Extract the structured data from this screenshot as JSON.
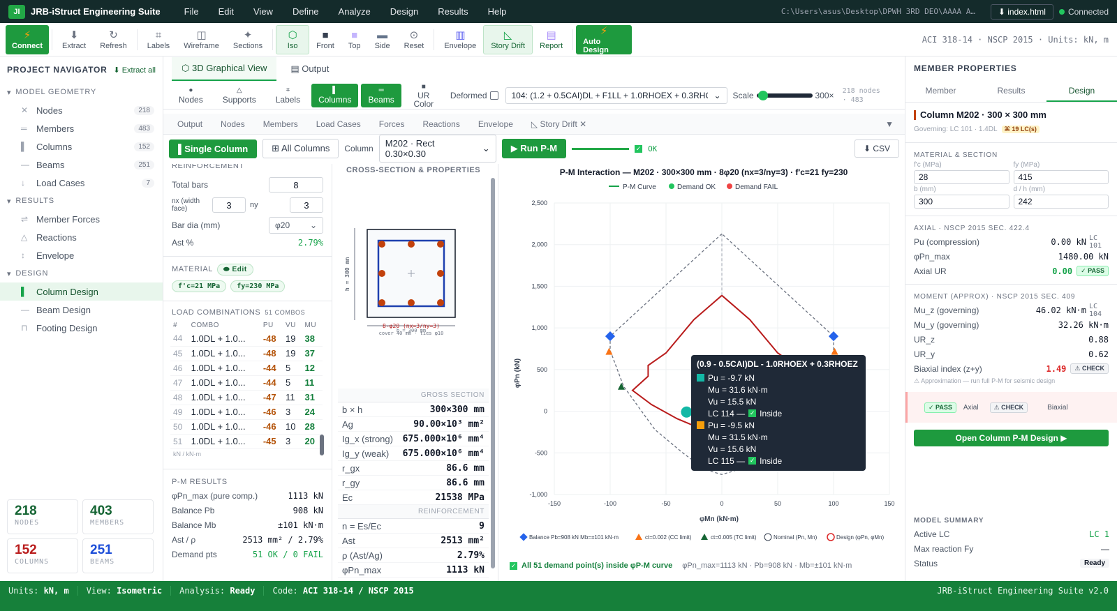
{
  "app": {
    "logo": "JI",
    "title": "JRB-iStruct Engineering Suite",
    "menus": [
      "File",
      "Edit",
      "View",
      "Define",
      "Analyze",
      "Design",
      "Results",
      "Help"
    ],
    "path": "C:\\Users\\asus\\Desktop\\DPWH 3RD DEO\\AAAA A…",
    "file": "⬇ index.html",
    "status": "Connected"
  },
  "toolbar": {
    "items": [
      "Connect",
      "Extract",
      "Refresh",
      "Labels",
      "Wireframe",
      "Sections",
      "Iso",
      "Front",
      "Top",
      "Side",
      "Reset",
      "Envelope",
      "Story Drift",
      "Report",
      "Auto Design"
    ],
    "code": "ACI 318-14 · NSCP 2015 · Units: kN, m"
  },
  "nav": {
    "title": "PROJECT NAVIGATOR",
    "extract": "⬇ Extract all",
    "sections": [
      "MODEL GEOMETRY",
      "RESULTS",
      "DESIGN"
    ],
    "geometry": [
      {
        "label": "Nodes",
        "count": "218"
      },
      {
        "label": "Members",
        "count": "483"
      },
      {
        "label": "Columns",
        "count": "152"
      },
      {
        "label": "Beams",
        "count": "251"
      },
      {
        "label": "Load Cases",
        "count": "7"
      }
    ],
    "results": [
      "Member Forces",
      "Reactions",
      "Envelope"
    ],
    "design": [
      "Column Design",
      "Beam Design",
      "Footing Design"
    ],
    "stats": [
      {
        "v": "218",
        "l": "NODES"
      },
      {
        "v": "403",
        "l": "MEMBERS"
      },
      {
        "v": "152",
        "l": "COLUMNS"
      },
      {
        "v": "251",
        "l": "BEAMS"
      }
    ]
  },
  "view": {
    "tabs": [
      "3D Graphical View",
      "Output"
    ],
    "filters": [
      "Nodes",
      "Supports",
      "Labels",
      "Columns",
      "Beams",
      "UR Color"
    ],
    "deformed": "Deformed",
    "combo": "104: (1.2 + 0.5CAI)DL + F1LL + 1.0RHOEX + 0.3RHOEZ",
    "scale_label": "Scale",
    "scale": "300×",
    "counts": "218 nodes · 483",
    "subtabs": [
      "Output",
      "Nodes",
      "Members",
      "Load Cases",
      "Forces",
      "Reactions",
      "Envelope",
      "Story Drift"
    ]
  },
  "ctrl": {
    "single": "Single Column",
    "all": "All Columns",
    "col_label": "Column",
    "column": "M202 · Rect 0.30×0.30",
    "run": "▶ Run P-M",
    "ok": "OK",
    "csv": "⬇ CSV"
  },
  "reinf": {
    "title": "REINFORCEMENT",
    "total_label": "Total bars",
    "total": "8",
    "nx_label": "nx (width face)",
    "nx": "3",
    "ny_label": "ny",
    "ny": "3",
    "dia_label": "Bar dia (mm)",
    "dia": "φ20",
    "ast_label": "Ast %",
    "ast": "2.79%"
  },
  "material": {
    "title": "MATERIAL",
    "edit": "Edit",
    "fc": "f'c=21 MPa",
    "fy": "fy=230 MPa"
  },
  "loads": {
    "title": "LOAD COMBINATIONS",
    "count": "51 COMBOS",
    "headers": [
      "#",
      "COMBO",
      "PU",
      "VU",
      "MU"
    ],
    "rows": [
      [
        "44",
        "1.0DL + 1.0...",
        "-48",
        "19",
        "38"
      ],
      [
        "45",
        "1.0DL + 1.0...",
        "-48",
        "19",
        "37"
      ],
      [
        "46",
        "1.0DL + 1.0...",
        "-44",
        "5",
        "12"
      ],
      [
        "47",
        "1.0DL + 1.0...",
        "-44",
        "5",
        "11"
      ],
      [
        "48",
        "1.0DL + 1.0...",
        "-47",
        "11",
        "31"
      ],
      [
        "49",
        "1.0DL + 1.0...",
        "-46",
        "3",
        "24"
      ],
      [
        "50",
        "1.0DL + 1.0...",
        "-46",
        "10",
        "28"
      ],
      [
        "51",
        "1.0DL + 1.0...",
        "-45",
        "3",
        "20"
      ]
    ],
    "units": "kN / kN·m"
  },
  "pm": {
    "title": "P-M RESULTS",
    "rows": [
      [
        "φPn_max (pure comp.)",
        "1113 kN"
      ],
      [
        "Balance Pb",
        "908 kN"
      ],
      [
        "Balance Mb",
        "±101 kN·m"
      ],
      [
        "Ast / ρ",
        "2513 mm² / 2.79%"
      ],
      [
        "Demand pts",
        "51 OK / 0 FAIL"
      ]
    ]
  },
  "section": {
    "title": "CROSS-SECTION & PROPERTIES",
    "h_label": "h = 300 mm",
    "bars_label": "8-φ20 (nx=3/ny=3)",
    "cover_label": "cover 40 mm · ties φ10",
    "b_label": "b = 300 mm",
    "gross_title": "GROSS SECTION",
    "gross": [
      [
        "b × h",
        "300×300 mm"
      ],
      [
        "Ag",
        "90.00×10³ mm²"
      ],
      [
        "Ig_x (strong)",
        "675.000×10⁶ mm⁴"
      ],
      [
        "Ig_y (weak)",
        "675.000×10⁶ mm⁴"
      ],
      [
        "r_gx",
        "86.6 mm"
      ],
      [
        "r_gy",
        "86.6 mm"
      ],
      [
        "Ec",
        "21538 MPa"
      ]
    ],
    "reinf_title": "REINFORCEMENT",
    "reinf": [
      [
        "n = Es/Ec",
        "9"
      ],
      [
        "Ast",
        "2513 mm²"
      ],
      [
        "ρ (Ast/Ag)",
        "2.79%"
      ],
      [
        "φPn_max",
        "1113 kN"
      ]
    ]
  },
  "chart_data": {
    "type": "line",
    "title": "P-M Interaction — M202 · 300×300 mm · 8φ20 (nx=3/ny=3) · f'c=21 fy=230",
    "xlabel": "φMn (kN·m)",
    "ylabel": "φPn (kN)",
    "xlim": [
      -150,
      150
    ],
    "ylim": [
      -1000,
      2500
    ],
    "xticks": [
      -150,
      -100,
      -50,
      0,
      50,
      100,
      150
    ],
    "yticks": [
      -1000,
      -500,
      0,
      500,
      1000,
      1500,
      2000,
      2500
    ],
    "grid": true,
    "legend": [
      "P-M Curve",
      "Demand OK",
      "Demand FAIL"
    ],
    "series": [
      {
        "name": "Nominal (Pn, Mn)",
        "style": "dashed",
        "x": [
          0,
          -100,
          -100,
          -88,
          -60,
          -35,
          -15,
          0,
          15,
          35,
          60,
          88,
          100,
          100,
          0
        ],
        "y": [
          2130,
          900,
          730,
          300,
          -220,
          -500,
          -700,
          -760,
          -700,
          -500,
          -220,
          300,
          730,
          900,
          2130
        ]
      },
      {
        "name": "Design (φPn, φMn)",
        "style": "solid",
        "x": [
          0,
          -25,
          -50,
          -66,
          -66,
          -80,
          -63,
          -40,
          -15,
          0,
          15,
          40,
          63,
          80,
          66,
          66,
          50,
          25,
          0
        ],
        "y": [
          1390,
          1100,
          700,
          550,
          420,
          250,
          80,
          -90,
          -230,
          -280,
          -230,
          -90,
          80,
          250,
          420,
          550,
          700,
          1100,
          1390
        ]
      }
    ],
    "points": [
      {
        "x": -100,
        "y": 900,
        "kind": "balance"
      },
      {
        "x": 100,
        "y": 900,
        "kind": "balance"
      },
      {
        "x": -101,
        "y": 720,
        "kind": "ct=0.002 (CC limit)"
      },
      {
        "x": 101,
        "y": 720,
        "kind": "ct=0.002 (CC limit)"
      },
      {
        "x": -90,
        "y": 300,
        "kind": "ct=0.005 (TC limit)"
      },
      {
        "x": 90,
        "y": 300,
        "kind": "ct=0.005 (TC limit)"
      },
      {
        "x": -31.6,
        "y": -9.7,
        "kind": "demand"
      },
      {
        "x": -20,
        "y": -9.5,
        "kind": "demand"
      }
    ],
    "bottom_legend": [
      "Balance  Pb=908 kN  Mb=±101 kN·m",
      "ct=0.002 (CC limit)",
      "ct=0.005 (TC limit)",
      "Nominal (Pn, Mn)",
      "Design (φPn, φMn)"
    ]
  },
  "tooltip": {
    "title": "(0.9 - 0.5CAI)DL - 1.0RHOEX + 0.3RHOEZ",
    "lines": [
      "Pu = -9.7 kN",
      "Mu = 31.6 kN·m",
      "Vu = 15.5 kN",
      "LC 114 —",
      "Inside",
      "Pu = -9.5 kN",
      "Mu = 31.5 kN·m",
      "Vu = 15.6 kN",
      "LC 115 —",
      "Inside"
    ]
  },
  "chart_footer": {
    "ok": "All 51 demand point(s) inside φP-M curve",
    "summary": "φPn_max=1113 kN · Pb=908 kN · Mb=±101 kN·m"
  },
  "props": {
    "title": "MEMBER PROPERTIES",
    "tabs": [
      "Member",
      "Results",
      "Design"
    ],
    "member": "Column  M202 · 300 × 300 mm",
    "governing": "Governing: LC 101 · 1.4DL",
    "lcs": "⌘ 19 LC(s)",
    "mat_title": "MATERIAL & SECTION",
    "fc_label": "f'c (MPa)",
    "fc": "28",
    "fy_label": "fy (MPa)",
    "fy": "415",
    "b_label": "b (mm)",
    "b": "300",
    "d_label": "d / h (mm)",
    "d": "242",
    "axial_title": "AXIAL · NSCP 2015 SEC. 422.4",
    "axial": [
      [
        "Pu (compression)",
        "0.00 kN",
        "LC 101"
      ],
      [
        "φPn_max",
        "1480.00 kN",
        ""
      ],
      [
        "Axial UR",
        "0.00",
        "PASS"
      ]
    ],
    "moment_title": "MOMENT (APPROX) · NSCP 2015 SEC. 409",
    "moment": [
      [
        "Mu_z (governing)",
        "46.02 kN·m",
        "LC 104"
      ],
      [
        "Mu_y (governing)",
        "32.26 kN·m",
        ""
      ],
      [
        "UR_z",
        "0.88",
        ""
      ],
      [
        "UR_y",
        "0.62",
        ""
      ],
      [
        "Biaxial index (z+y)",
        "1.49",
        "CHECK"
      ]
    ],
    "note": "⚠ Approximation — run full P-M for seismic design",
    "summary_badges": [
      "PASS",
      "Axial",
      "CHECK",
      "Biaxial"
    ],
    "open": "Open Column P-M Design ▶",
    "model_title": "MODEL SUMMARY",
    "model": [
      [
        "Active LC",
        "LC 1"
      ],
      [
        "Max reaction Fy",
        "—"
      ],
      [
        "Status",
        "Ready"
      ]
    ]
  },
  "status": {
    "units": "kN, m",
    "view": "Isometric",
    "analysis": "Ready",
    "code": "ACI 318-14 / NSCP 2015",
    "right": "JRB-iStruct Engineering Suite v2.0"
  }
}
